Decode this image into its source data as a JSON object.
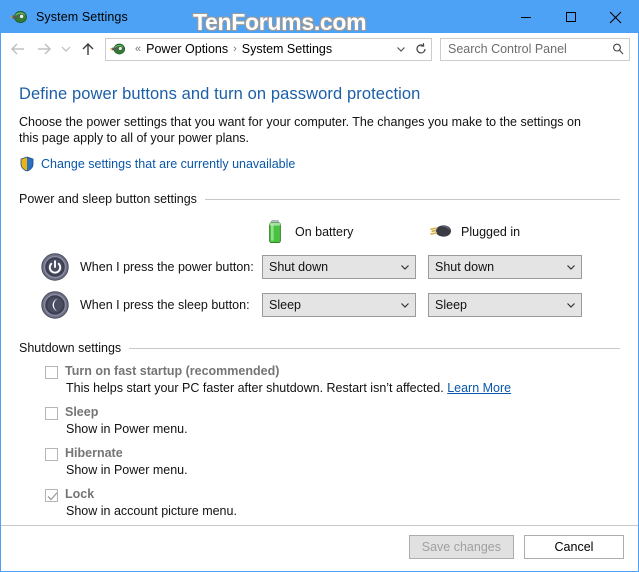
{
  "window": {
    "title": "System Settings",
    "icon": "power-options-icon",
    "watermark": "TenForums.com",
    "caption": {
      "minimize": "minimize-icon",
      "maximize": "maximize-icon",
      "close": "close-icon"
    }
  },
  "navbar": {
    "back": "back-arrow-icon",
    "forward": "forward-arrow-icon",
    "recent": "recent-locations-chevron-icon",
    "up": "up-arrow-icon",
    "address_icon": "power-options-icon",
    "breadcrumb_prefix": "«",
    "breadcrumbs": [
      "Power Options",
      "System Settings"
    ],
    "breadcrumb_separator": "›",
    "dropdown": "address-chevron-down-icon",
    "refresh": "refresh-icon",
    "search": {
      "placeholder": "Search Control Panel",
      "icon": "search-icon"
    }
  },
  "page": {
    "title": "Define power buttons and turn on password protection",
    "description": "Choose the power settings that you want for your computer. The changes you make to the settings on this page apply to all of your power plans.",
    "uac_link": "Change settings that are currently unavailable",
    "uac_icon": "uac-shield-icon"
  },
  "power_group": {
    "label": "Power and sleep button settings",
    "columns": [
      {
        "label": "On battery",
        "icon": "battery-icon"
      },
      {
        "label": "Plugged in",
        "icon": "power-plug-icon"
      }
    ],
    "rows": [
      {
        "icon": "power-button-icon",
        "label": "When I press the power button:",
        "on_battery": "Shut down",
        "plugged_in": "Shut down"
      },
      {
        "icon": "sleep-button-icon",
        "label": "When I press the sleep button:",
        "on_battery": "Sleep",
        "plugged_in": "Sleep"
      }
    ]
  },
  "shutdown_group": {
    "label": "Shutdown settings",
    "items": [
      {
        "label": "Turn on fast startup (recommended)",
        "checked": false,
        "description": "This helps start your PC faster after shutdown. Restart isn’t affected. ",
        "link": "Learn More"
      },
      {
        "label": "Sleep",
        "checked": false,
        "description": "Show in Power menu.",
        "link": ""
      },
      {
        "label": "Hibernate",
        "checked": false,
        "description": "Show in Power menu.",
        "link": ""
      },
      {
        "label": "Lock",
        "checked": true,
        "description": "Show in account picture menu.",
        "link": ""
      }
    ]
  },
  "footer": {
    "save_label": "Save changes",
    "save_enabled": false,
    "cancel_label": "Cancel",
    "cancel_enabled": true
  },
  "colors": {
    "titlebar": "#4da2f5",
    "window_border": "#4ea1f7",
    "heading": "#1c5fa8",
    "link": "#0a57a8",
    "combo_bg": "#e4e4e4",
    "rule": "#c8c8c8"
  }
}
